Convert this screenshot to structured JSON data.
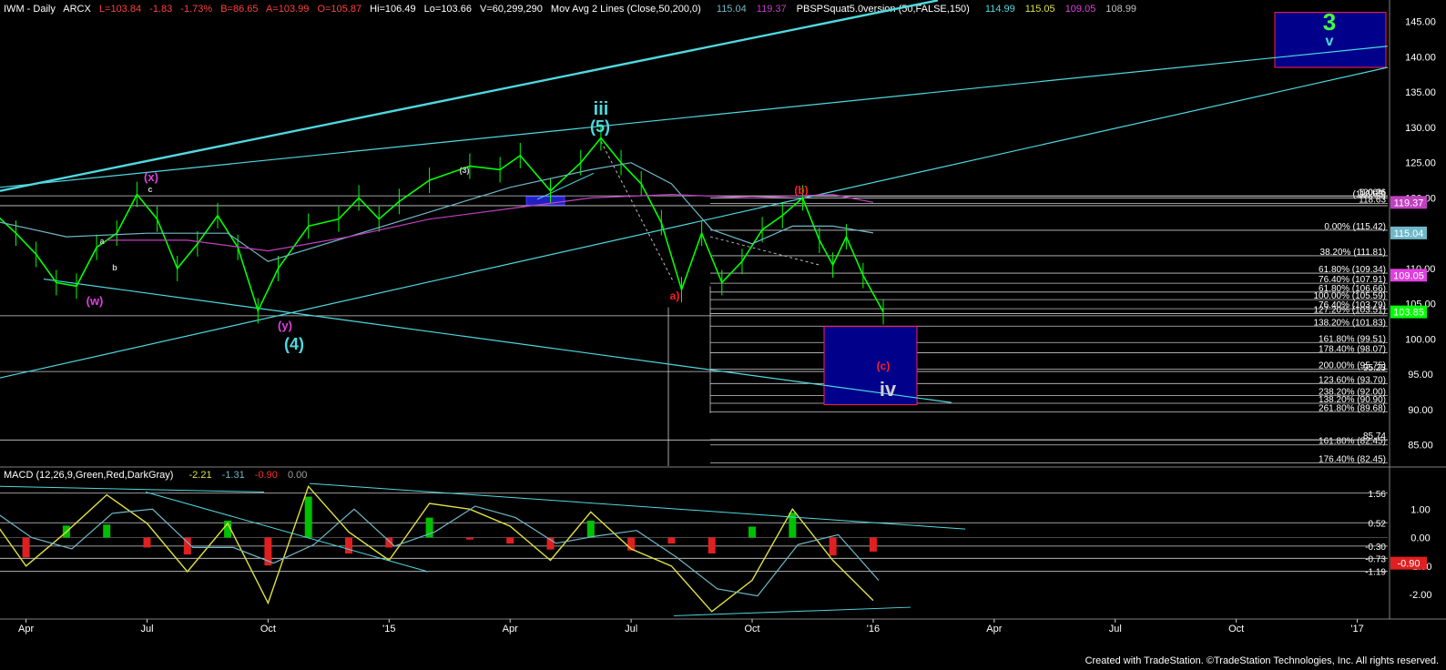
{
  "header": {
    "symbol": "IWM - Daily",
    "exchange": "ARCX",
    "last": "L=103.84",
    "change": "-1.83",
    "change_pct": "-1.73%",
    "bid": "B=86.65",
    "ask": "A=103.99",
    "open": "O=105.87",
    "high": "Hi=106.49",
    "low": "Lo=103.66",
    "volume": "V=60,299,290",
    "ma_study": "Mov Avg 2 Lines (Close,50,200,0)",
    "ma_val1": "115.04",
    "ma_val2": "119.37",
    "pbsp_study": "PBSPSquat5.0version (50,FALSE,150)",
    "pbsp_val1": "114.99",
    "pbsp_val2": "115.05",
    "pbsp_val3": "109.05",
    "pbsp_val4": "108.99"
  },
  "macd_header": {
    "study": "MACD (12,26,9,Green,Red,DarkGray)",
    "v1": "-2.21",
    "v2": "-1.31",
    "v3": "-0.90",
    "v4": "0.00"
  },
  "footer": "Created with TradeStation. ©TradeStation Technologies, Inc. All rights reserved.",
  "colors": {
    "price": "#00ff00",
    "trendline": "#4fd9e0",
    "ma50": "#6fb8c8",
    "ma200": "#c040c0",
    "wave_cyan": "#4fd9e0",
    "wave_magenta": "#e040e0",
    "wave_red": "#ff2020",
    "wave_green": "#40ff40",
    "target_box": "#00008b",
    "target_border": "#ff2050"
  },
  "wave_labels": {
    "w": "(w)",
    "x": "(x)",
    "y": "(y)",
    "wave4": "(4)",
    "iii": "iii",
    "wave5": "(5)",
    "a": "a)",
    "b": "(b)",
    "c": "(c)",
    "iv": "iv",
    "three": "3",
    "v": "v",
    "small_a": "a",
    "small_b": "b",
    "small_c": "c",
    "small_3": "(3)"
  },
  "fib_labels": [
    {
      "text": "0.00%",
      "price": 120.26
    },
    {
      "text": "120.26",
      "price": 120.26
    },
    {
      "text": "(118.65)",
      "price": 120.0
    },
    {
      "text": "118.63",
      "price": 119.2
    },
    {
      "text": "0.00% (115.42)",
      "price": 115.42
    },
    {
      "text": "38.20% (111.81)",
      "price": 111.81
    },
    {
      "text": "61.80% (109.34)",
      "price": 109.34
    },
    {
      "text": "76.40% (107.91)",
      "price": 107.91
    },
    {
      "text": "61.80% (106.66)",
      "price": 106.66
    },
    {
      "text": "100.00% (105.59)",
      "price": 105.59
    },
    {
      "text": "76.40% (103.79)",
      "price": 104.3
    },
    {
      "text": "127.20% (103.51)",
      "price": 103.6
    },
    {
      "text": "138.20% (101.83)",
      "price": 101.83
    },
    {
      "text": "161.80% (99.51)",
      "price": 99.51
    },
    {
      "text": "178.40% (98.07)",
      "price": 98.07
    },
    {
      "text": "200.00% (95.75)",
      "price": 95.75
    },
    {
      "text": "95.23",
      "price": 95.4
    },
    {
      "text": "123.60% (93.70)",
      "price": 93.7
    },
    {
      "text": "238.20% (92.00)",
      "price": 92.0
    },
    {
      "text": "138.20% (90.90)",
      "price": 90.9
    },
    {
      "text": "261.80% (89.68)",
      "price": 89.68
    },
    {
      "text": "85.74",
      "price": 85.74
    },
    {
      "text": "161.80% (82.45)",
      "price": 85.0
    },
    {
      "text": "176.40% (82.45)",
      "price": 82.45
    }
  ],
  "price_axis_badges": [
    {
      "text": "119.37",
      "price": 119.37,
      "bg": "#c040c0"
    },
    {
      "text": "115.04",
      "price": 115.04,
      "bg": "#6fb8c8"
    },
    {
      "text": "109.05",
      "price": 109.05,
      "bg": "#e040e0"
    },
    {
      "text": "103.85",
      "price": 103.85,
      "bg": "#00ff00"
    }
  ],
  "macd_levels": [
    {
      "text": "1.56",
      "value": 1.56
    },
    {
      "text": "0.52",
      "value": 0.52
    },
    {
      "text": "-0.30",
      "value": -0.3
    },
    {
      "text": "-0.73",
      "value": -0.73
    },
    {
      "text": "-1.19",
      "value": -1.19
    }
  ],
  "macd_badge": {
    "text": "-0.90",
    "value": -0.9
  },
  "chart_data": [
    {
      "type": "line",
      "title": "",
      "series": [
        {
          "name": "IWM",
          "points": [
            [
              "Mar 2014",
              119.0
            ],
            [
              "Apr 2014",
              115.0
            ],
            [
              "Apr 2014",
              112.0
            ],
            [
              "May 2014",
              108.0
            ],
            [
              "May 2014",
              107.5
            ],
            [
              "Jun 2014",
              113.0
            ],
            [
              "Jun 2014",
              115.0
            ],
            [
              "Jul 2014",
              120.5
            ],
            [
              "Jul 2014",
              117.0
            ],
            [
              "Aug 2014",
              110.0
            ],
            [
              "Aug 2014",
              113.5
            ],
            [
              "Sep 2014",
              117.5
            ],
            [
              "Sep 2014",
              113.0
            ],
            [
              "Oct 2014",
              104.0
            ],
            [
              "Oct 2014",
              110.0
            ],
            [
              "Nov 2014",
              116.0
            ],
            [
              "Dec 2014",
              117.0
            ],
            [
              "Dec 2014",
              120.0
            ],
            [
              "Jan 2015",
              117.0
            ],
            [
              "Jan 2015",
              119.5
            ],
            [
              "Feb 2015",
              122.5
            ],
            [
              "Mar 2015",
              124.5
            ],
            [
              "Apr 2015",
              124.0
            ],
            [
              "Apr 2015",
              126.0
            ],
            [
              "May 2015",
              121.0
            ],
            [
              "Jun 2015",
              125.0
            ],
            [
              "Jun 2015",
              128.5
            ],
            [
              "Jul 2015",
              125.0
            ],
            [
              "Jul 2015",
              122.0
            ],
            [
              "Aug 2015",
              116.5
            ],
            [
              "Aug 2015",
              107.0
            ],
            [
              "Sep 2015",
              115.0
            ],
            [
              "Sep 2015",
              108.0
            ],
            [
              "Oct 2015",
              111.0
            ],
            [
              "Oct 2015",
              115.5
            ],
            [
              "Nov 2015",
              117.5
            ],
            [
              "Nov 2015",
              120.0
            ],
            [
              "Dec 2015",
              114.0
            ],
            [
              "Dec 2015",
              110.5
            ],
            [
              "Dec 2015",
              114.5
            ],
            [
              "Jan 2016",
              109.0
            ],
            [
              "Jan 2016",
              103.85
            ]
          ]
        },
        {
          "name": "MA50",
          "points": [
            [
              "Mar 2014",
              117.0
            ],
            [
              "May 2014",
              114.5
            ],
            [
              "Jul 2014",
              115.0
            ],
            [
              "Sep 2014",
              115.0
            ],
            [
              "Oct 2014",
              111.0
            ],
            [
              "Dec 2014",
              114.5
            ],
            [
              "Feb 2015",
              118.0
            ],
            [
              "Apr 2015",
              121.5
            ],
            [
              "Jun 2015",
              124.0
            ],
            [
              "Jul 2015",
              125.0
            ],
            [
              "Aug 2015",
              122.0
            ],
            [
              "Sep 2015",
              115.5
            ],
            [
              "Oct 2015",
              113.5
            ],
            [
              "Nov 2015",
              116.0
            ],
            [
              "Dec 2015",
              116.0
            ],
            [
              "Jan 2016",
              115.04
            ]
          ]
        },
        {
          "name": "MA200",
          "points": [
            [
              "Jun 2014",
              114.0
            ],
            [
              "Aug 2014",
              114.0
            ],
            [
              "Oct 2014",
              112.5
            ],
            [
              "Dec 2014",
              114.5
            ],
            [
              "Feb 2015",
              117.0
            ],
            [
              "Apr 2015",
              118.5
            ],
            [
              "Jun 2015",
              120.0
            ],
            [
              "Aug 2015",
              120.5
            ],
            [
              "Oct 2015",
              120.0
            ],
            [
              "Dec 2015",
              120.5
            ],
            [
              "Jan 2016",
              119.37
            ]
          ]
        }
      ],
      "x_ticks": [
        "Apr",
        "Jul",
        "Oct",
        "'15",
        "Apr",
        "Jul",
        "Oct",
        "'16",
        "Apr",
        "Jul",
        "Oct",
        "'17"
      ],
      "y_ticks": [
        "145.00",
        "140.00",
        "135.00",
        "130.00",
        "125.00",
        "120.00",
        "110.00",
        "105.00",
        "100.00",
        "95.00",
        "90.00",
        "85.00"
      ],
      "ylim": [
        82.0,
        146.5
      ]
    },
    {
      "type": "line",
      "title": "",
      "series": [
        {
          "name": "MACD",
          "points": [
            [
              "Mar 2014",
              1.0
            ],
            [
              "Apr 2014",
              -1.0
            ],
            [
              "May 2014",
              0.2
            ],
            [
              "Jun 2014",
              1.5
            ],
            [
              "Jul 2014",
              0.5
            ],
            [
              "Aug 2014",
              -1.2
            ],
            [
              "Sep 2014",
              0.5
            ],
            [
              "Oct 2014",
              -2.3
            ],
            [
              "Nov 2014",
              1.8
            ],
            [
              "Dec 2014",
              0.2
            ],
            [
              "Jan 2015",
              -0.8
            ],
            [
              "Feb 2015",
              1.2
            ],
            [
              "Mar 2015",
              1.0
            ],
            [
              "Apr 2015",
              0.4
            ],
            [
              "May 2015",
              -0.8
            ],
            [
              "Jun 2015",
              0.9
            ],
            [
              "Jul 2015",
              -0.4
            ],
            [
              "Aug 2015",
              -1.0
            ],
            [
              "Sep 2015",
              -2.6
            ],
            [
              "Oct 2015",
              -1.5
            ],
            [
              "Nov 2015",
              1.0
            ],
            [
              "Dec 2015",
              -0.8
            ],
            [
              "Jan 2016",
              -2.21
            ]
          ]
        }
      ],
      "y_ticks": [
        "1.00",
        "0.00",
        "-1.00",
        "-2.00"
      ],
      "ylim": [
        -2.8,
        2.0
      ]
    }
  ]
}
